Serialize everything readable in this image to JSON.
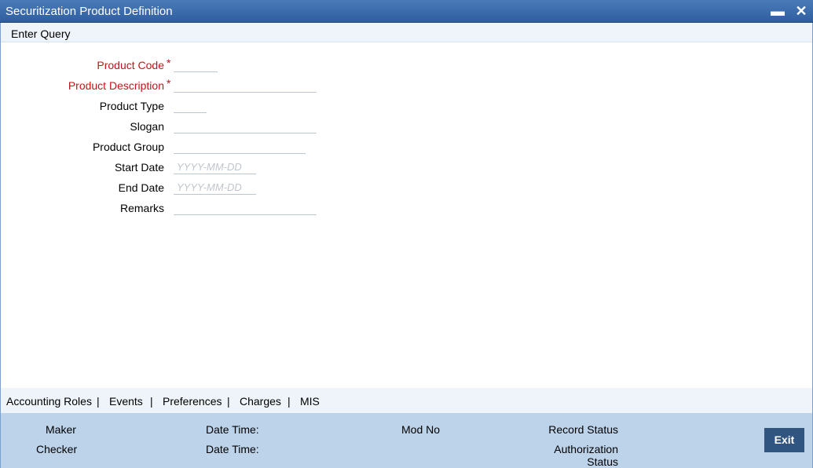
{
  "window": {
    "title": "Securitization Product Definition",
    "minimize_glyph": "▬",
    "close_glyph": "✕"
  },
  "toolbar": {
    "enter_query": "Enter Query"
  },
  "form": {
    "required_mark": "*",
    "product_code": {
      "label": "Product Code",
      "value": ""
    },
    "product_description": {
      "label": "Product Description",
      "value": ""
    },
    "product_type": {
      "label": "Product Type",
      "value": ""
    },
    "slogan": {
      "label": "Slogan",
      "value": ""
    },
    "product_group": {
      "label": "Product Group",
      "value": ""
    },
    "start_date": {
      "label": "Start Date",
      "placeholder": "YYYY-MM-DD"
    },
    "end_date": {
      "label": "End Date",
      "placeholder": "YYYY-MM-DD"
    },
    "remarks": {
      "label": "Remarks",
      "value": ""
    }
  },
  "tabs": {
    "items": [
      "Accounting Roles",
      "Events",
      "Preferences",
      "Charges",
      "MIS"
    ],
    "separator": "|"
  },
  "footer": {
    "maker": "Maker",
    "checker": "Checker",
    "date_time": "Date Time:",
    "mod_no": "Mod No",
    "record_status": "Record Status",
    "authorization": "Authorization",
    "status": "Status",
    "exit": "Exit"
  }
}
